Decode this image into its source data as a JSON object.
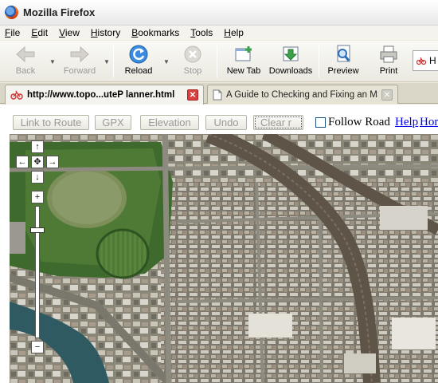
{
  "window": {
    "title": "Mozilla Firefox"
  },
  "menu": [
    {
      "label": "File",
      "u": "F",
      "rest": "ile"
    },
    {
      "label": "Edit",
      "u": "E",
      "rest": "dit"
    },
    {
      "label": "View",
      "u": "V",
      "rest": "iew"
    },
    {
      "label": "History",
      "u": "H",
      "rest": "istory"
    },
    {
      "label": "Bookmarks",
      "u": "B",
      "rest": "ookmarks"
    },
    {
      "label": "Tools",
      "u": "T",
      "rest": "ools"
    },
    {
      "label": "Help",
      "u": "H",
      "rest": "elp"
    }
  ],
  "toolbar": {
    "back": "Back",
    "forward": "Forward",
    "reload": "Reload",
    "stop": "Stop",
    "new_tab": "New Tab",
    "downloads": "Downloads",
    "preview": "Preview",
    "print": "Print",
    "bookmark_partial": "H"
  },
  "tabs": [
    {
      "label": "http://www.topo...uteP lanner.html",
      "active": true
    },
    {
      "label": "A Guide to Checking and Fixing an MS...",
      "active": false
    }
  ],
  "app": {
    "buttons": {
      "link_to_route": "Link to Route",
      "gpx": "GPX",
      "elevation": "Elevation",
      "undo": "Undo",
      "clear": "Clear r"
    },
    "follow_road": "Follow Road",
    "help_link": "Help",
    "home_link": "Hor"
  },
  "map_controls": {
    "pan_up": "↑",
    "pan_down": "↓",
    "pan_left": "←",
    "pan_right": "→",
    "zoom_in": "+",
    "zoom_out": "−",
    "zoom_level": 0.95
  },
  "colors": {
    "link": "#0000ee",
    "close_active": "#d94141",
    "reload_blue": "#2f7fd6",
    "downloads_green": "#3aa24a"
  }
}
